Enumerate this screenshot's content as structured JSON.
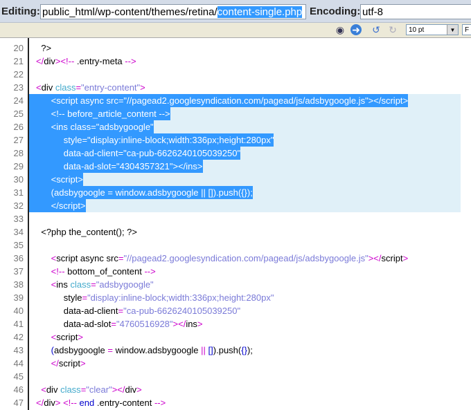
{
  "header": {
    "editing_label": "Editing:",
    "path_prefix": "public_html/wp-content/themes/retina/",
    "path_selected": "content-single.php",
    "encoding_label": "Encoding:",
    "encoding_value": "utf-8"
  },
  "toolbar": {
    "font_size": "10 pt",
    "font_size_2": "F",
    "icons": [
      "find-icon",
      "go-icon",
      "undo-icon",
      "redo-icon"
    ]
  },
  "colors": {
    "selection": "#3399ff",
    "selection_line": "#e0f0f8",
    "punct": "#cc00cc",
    "attr": "#44aacc",
    "string": "#7a7ad8"
  },
  "lines": [
    {
      "n": "20",
      "tokens": [
        [
          "t",
          "  ?>"
        ]
      ]
    },
    {
      "n": "21",
      "tokens": [
        [
          "p",
          "</"
        ],
        [
          "t",
          "div"
        ],
        [
          "p",
          ">"
        ],
        [
          "p",
          "<!-- "
        ],
        [
          "t",
          ".entry-meta "
        ],
        [
          "p",
          "-->"
        ]
      ]
    },
    {
      "n": "22",
      "tokens": []
    },
    {
      "n": "23",
      "tokens": [
        [
          "p",
          "<"
        ],
        [
          "t",
          "div "
        ],
        [
          "a",
          "class"
        ],
        [
          "p",
          "="
        ],
        [
          "s",
          "\"entry-content\""
        ],
        [
          "p",
          ">"
        ]
      ]
    },
    {
      "n": "24",
      "sel": true,
      "tokens": [
        [
          "t",
          "      <script async src=\"//pagead2.googlesyndication.com/pagead/js/adsbygoogle.js\"></script>"
        ]
      ]
    },
    {
      "n": "25",
      "sel": true,
      "tokens": [
        [
          "t",
          "      <!-- before_article_content -->"
        ]
      ]
    },
    {
      "n": "26",
      "sel": true,
      "tokens": [
        [
          "t",
          "      <ins class=\"adsbygoogle\""
        ]
      ]
    },
    {
      "n": "27",
      "sel": true,
      "tokens": [
        [
          "t",
          "           style=\"display:inline-block;width:336px;height:280px\""
        ]
      ]
    },
    {
      "n": "28",
      "sel": true,
      "tokens": [
        [
          "t",
          "           data-ad-client=\"ca-pub-6626240105039250\""
        ]
      ]
    },
    {
      "n": "29",
      "sel": true,
      "tokens": [
        [
          "t",
          "           data-ad-slot=\"4304357321\"></ins>"
        ]
      ]
    },
    {
      "n": "30",
      "sel": true,
      "tokens": [
        [
          "t",
          "      <script>"
        ]
      ]
    },
    {
      "n": "31",
      "sel": true,
      "tokens": [
        [
          "t",
          "      (adsbygoogle = window.adsbygoogle || []).push({});"
        ]
      ]
    },
    {
      "n": "32",
      "sel": true,
      "tokens": [
        [
          "t",
          "      </script>"
        ]
      ]
    },
    {
      "n": "33",
      "tokens": []
    },
    {
      "n": "34",
      "tokens": [
        [
          "t",
          "  <?php the_content(); ?>"
        ]
      ]
    },
    {
      "n": "35",
      "tokens": []
    },
    {
      "n": "36",
      "tokens": [
        [
          "t",
          "      "
        ],
        [
          "p",
          "<"
        ],
        [
          "t",
          "script async src"
        ],
        [
          "p",
          "="
        ],
        [
          "s",
          "\"//pagead2.googlesyndication.com/pagead/js/adsbygoogle.js\""
        ],
        [
          "p",
          "></"
        ],
        [
          "t",
          "script"
        ],
        [
          "p",
          ">"
        ]
      ]
    },
    {
      "n": "37",
      "tokens": [
        [
          "t",
          "      "
        ],
        [
          "p",
          "<!-- "
        ],
        [
          "t",
          "bottom_of_content "
        ],
        [
          "p",
          "-->"
        ]
      ]
    },
    {
      "n": "38",
      "tokens": [
        [
          "t",
          "      "
        ],
        [
          "p",
          "<"
        ],
        [
          "t",
          "ins "
        ],
        [
          "a",
          "class"
        ],
        [
          "p",
          "="
        ],
        [
          "s",
          "\"adsbygoogle\""
        ]
      ]
    },
    {
      "n": "39",
      "tokens": [
        [
          "t",
          "           style"
        ],
        [
          "p",
          "="
        ],
        [
          "s",
          "\"display:inline-block;width:336px;height:280px\""
        ]
      ]
    },
    {
      "n": "40",
      "tokens": [
        [
          "t",
          "           data-ad-client"
        ],
        [
          "p",
          "="
        ],
        [
          "s",
          "\"ca-pub-6626240105039250\""
        ]
      ]
    },
    {
      "n": "41",
      "tokens": [
        [
          "t",
          "           data-ad-slot"
        ],
        [
          "p",
          "="
        ],
        [
          "s",
          "\"4760516928\""
        ],
        [
          "p",
          "></"
        ],
        [
          "t",
          "ins"
        ],
        [
          "p",
          ">"
        ]
      ]
    },
    {
      "n": "42",
      "tokens": [
        [
          "t",
          "      "
        ],
        [
          "p",
          "<"
        ],
        [
          "t",
          "script"
        ],
        [
          "p",
          ">"
        ]
      ]
    },
    {
      "n": "43",
      "tokens": [
        [
          "t",
          "      "
        ],
        [
          "k",
          "("
        ],
        [
          "t",
          "adsbygoogle "
        ],
        [
          "p",
          "="
        ],
        [
          "t",
          " window.adsbygoogle "
        ],
        [
          "p",
          "||"
        ],
        [
          "t",
          " "
        ],
        [
          "k",
          "[]"
        ],
        [
          "t",
          ").push("
        ],
        [
          "k",
          "{}"
        ],
        [
          "t",
          ");"
        ]
      ]
    },
    {
      "n": "44",
      "tokens": [
        [
          "t",
          "      "
        ],
        [
          "p",
          "</"
        ],
        [
          "t",
          "script"
        ],
        [
          "p",
          ">"
        ]
      ]
    },
    {
      "n": "45",
      "tokens": []
    },
    {
      "n": "46",
      "tokens": [
        [
          "t",
          "  "
        ],
        [
          "p",
          "<"
        ],
        [
          "t",
          "div "
        ],
        [
          "a",
          "class"
        ],
        [
          "p",
          "="
        ],
        [
          "s",
          "\"clear\""
        ],
        [
          "p",
          "></"
        ],
        [
          "t",
          "div"
        ],
        [
          "p",
          ">"
        ]
      ]
    },
    {
      "n": "47",
      "tokens": [
        [
          "p",
          "</"
        ],
        [
          "t",
          "div"
        ],
        [
          "p",
          ">"
        ],
        [
          "t",
          " "
        ],
        [
          "p",
          "<!-- "
        ],
        [
          "k",
          "end"
        ],
        [
          "t",
          " .entry-content "
        ],
        [
          "p",
          "-->"
        ]
      ]
    }
  ]
}
